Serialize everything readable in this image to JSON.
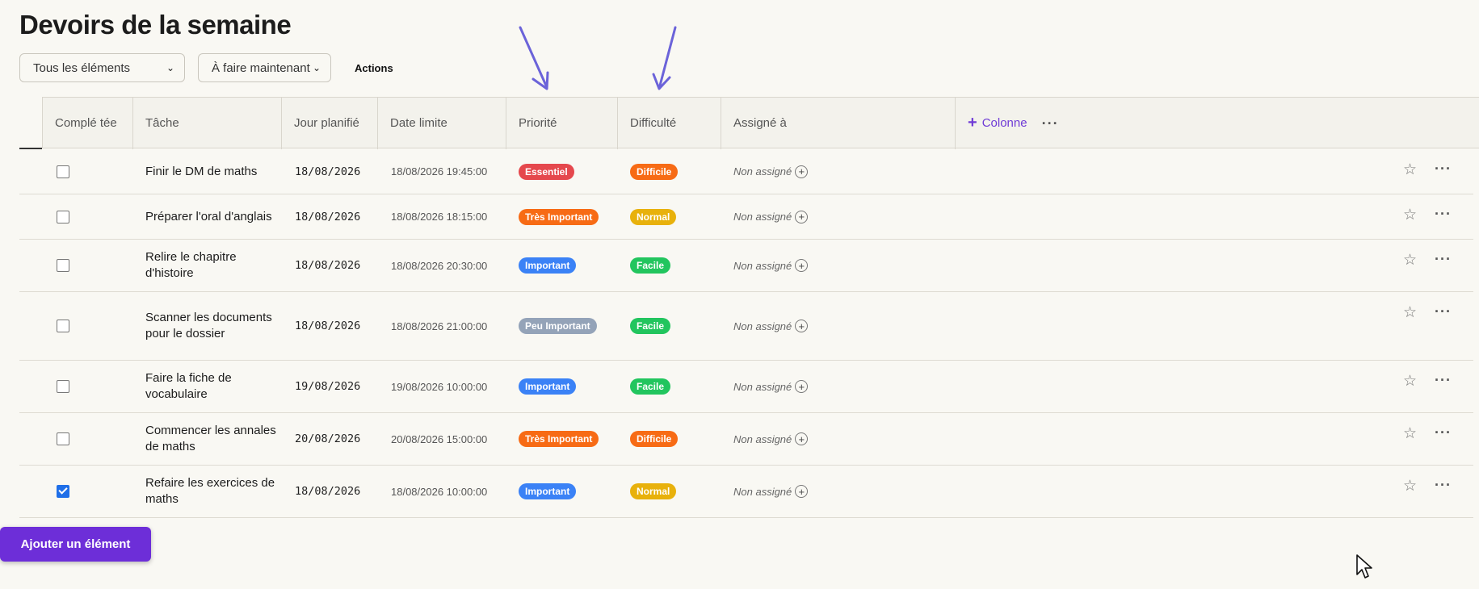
{
  "page": {
    "title": "Devoirs de la semaine"
  },
  "toolbar": {
    "filter_select": "Tous les éléments",
    "status_select": "À faire maintenant",
    "actions_label": "Actions"
  },
  "table": {
    "columns": {
      "done": "Complé tée",
      "task": "Tâche",
      "day": "Jour planifié",
      "deadline": "Date limite",
      "priority": "Priorité",
      "difficulty": "Difficulté",
      "assigned": "Assigné à",
      "add_column": "Colonne"
    },
    "rows": [
      {
        "done": false,
        "task": "Finir le DM de maths",
        "day": "18/08/2026",
        "deadline": "18/08/2026 19:45:00",
        "priority": "Essentiel",
        "difficulty": "Difficile",
        "assigned": "Non assigné"
      },
      {
        "done": false,
        "task": "Préparer l'oral d'anglais",
        "day": "18/08/2026",
        "deadline": "18/08/2026 18:15:00",
        "priority": "Très Important",
        "difficulty": "Normal",
        "assigned": "Non assigné"
      },
      {
        "done": false,
        "task": "Relire le chapitre d'histoire",
        "day": "18/08/2026",
        "deadline": "18/08/2026 20:30:00",
        "priority": "Important",
        "difficulty": "Facile",
        "assigned": "Non assigné"
      },
      {
        "done": false,
        "task": "Scanner les documents pour le dossier",
        "day": "18/08/2026",
        "deadline": "18/08/2026 21:00:00",
        "priority": "Peu Important",
        "difficulty": "Facile",
        "assigned": "Non assigné"
      },
      {
        "done": false,
        "task": "Faire la fiche de vocabulaire",
        "day": "19/08/2026",
        "deadline": "19/08/2026 10:00:00",
        "priority": "Important",
        "difficulty": "Facile",
        "assigned": "Non assigné"
      },
      {
        "done": false,
        "task": "Commencer les annales de maths",
        "day": "20/08/2026",
        "deadline": "20/08/2026 15:00:00",
        "priority": "Très Important",
        "difficulty": "Difficile",
        "assigned": "Non assigné"
      },
      {
        "done": true,
        "task": "Refaire les exercices de maths",
        "day": "18/08/2026",
        "deadline": "18/08/2026 10:00:00",
        "priority": "Important",
        "difficulty": "Normal",
        "assigned": "Non assigné"
      }
    ]
  },
  "badge_colors": {
    "Essentiel": "#e5484d",
    "Très Important": "#f76b15",
    "Important": "#3b82f6",
    "Peu Important": "#94a3b8",
    "Difficile": "#f76b15",
    "Normal": "#e8b10c",
    "Facile": "#22c55e"
  },
  "annotation_arrow_color": "#6b63d9",
  "footer": {
    "add_button": "Ajouter un élément"
  }
}
